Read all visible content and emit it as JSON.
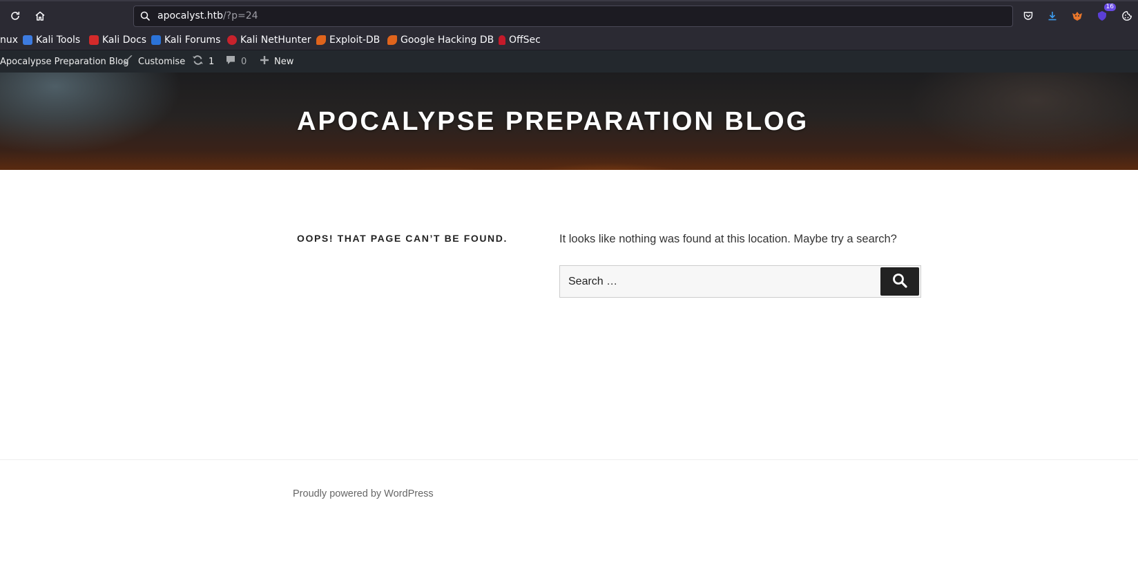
{
  "browser": {
    "url_host": "apocalyst.htb",
    "url_path": "/?p=24",
    "extension_badge": "16",
    "icons": [
      "reload-icon",
      "home-icon",
      "search-icon",
      "pocket-icon",
      "downloads-icon",
      "extension-fox-icon",
      "extension-shield-icon",
      "cookie-icon"
    ]
  },
  "bookmarks": [
    {
      "label": "nux",
      "icon": null,
      "color": null
    },
    {
      "label": "Kali Tools",
      "icon": "kali-tools-icon",
      "color": "#3d7be0"
    },
    {
      "label": "Kali Docs",
      "icon": "kali-docs-icon",
      "color": "#d42a2a"
    },
    {
      "label": "Kali Forums",
      "icon": "kali-forums-icon",
      "color": "#2b73d9"
    },
    {
      "label": "Kali NetHunter",
      "icon": "kali-nethunter-icon",
      "color": "#c8222c"
    },
    {
      "label": "Exploit-DB",
      "icon": "exploit-db-icon",
      "color": "#e0641c"
    },
    {
      "label": "Google Hacking DB",
      "icon": "ghdb-icon",
      "color": "#e0641c"
    },
    {
      "label": "OffSec",
      "icon": "offsec-icon",
      "color": "#c41a2a"
    }
  ],
  "adminbar": {
    "site_name": "Apocalypse Preparation Blog",
    "customise": "Customise",
    "updates_count": "1",
    "comments_count": "0",
    "new": "New"
  },
  "header": {
    "site_title": "APOCALYPSE PREPARATION BLOG"
  },
  "content": {
    "title": "OOPS! THAT PAGE CAN’T BE FOUND.",
    "message": "It looks like nothing was found at this location. Maybe try a search?",
    "search_placeholder": "Search …"
  },
  "footer": {
    "credit": "Proudly powered by WordPress"
  },
  "colors": {
    "chrome_bg": "#2b2a33",
    "adminbar_bg": "#23282d",
    "search_button": "#222222"
  }
}
